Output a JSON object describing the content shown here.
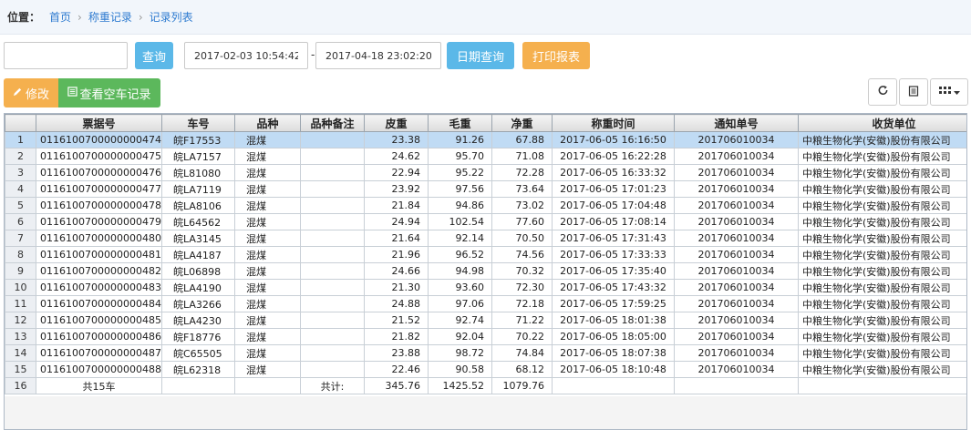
{
  "breadcrumb": {
    "label": "位置：",
    "items": [
      "首页",
      "称重记录",
      "记录列表"
    ],
    "sep": "›"
  },
  "search": {
    "keyword_value": "",
    "query_label": "查询",
    "date_start": "2017-02-03 10:54:42",
    "date_sep": "-",
    "date_end": "2017-04-18 23:02:20",
    "date_query_label": "日期查询",
    "print_label": "打印报表"
  },
  "actions": {
    "edit_label": "修改",
    "empty_label": "查看空车记录"
  },
  "tools": {
    "refresh_icon": "refresh-icon",
    "list_icon": "list-icon",
    "columns_icon": "grid-columns-icon"
  },
  "table": {
    "columns": [
      "",
      "票据号",
      "车号",
      "品种",
      "品种备注",
      "皮重",
      "毛重",
      "净重",
      "称重时间",
      "通知单号",
      "收货单位"
    ],
    "rows": [
      [
        "1",
        "0116100700000000474",
        "皖F17553",
        "混煤",
        "",
        "23.38",
        "91.26",
        "67.88",
        "2017-06-05 16:16:50",
        "201706010034",
        "中粮生物化学(安徽)股份有限公司"
      ],
      [
        "2",
        "0116100700000000475",
        "皖LA7157",
        "混煤",
        "",
        "24.62",
        "95.70",
        "71.08",
        "2017-06-05 16:22:28",
        "201706010034",
        "中粮生物化学(安徽)股份有限公司"
      ],
      [
        "3",
        "0116100700000000476",
        "皖L81080",
        "混煤",
        "",
        "22.94",
        "95.22",
        "72.28",
        "2017-06-05 16:33:32",
        "201706010034",
        "中粮生物化学(安徽)股份有限公司"
      ],
      [
        "4",
        "0116100700000000477",
        "皖LA7119",
        "混煤",
        "",
        "23.92",
        "97.56",
        "73.64",
        "2017-06-05 17:01:23",
        "201706010034",
        "中粮生物化学(安徽)股份有限公司"
      ],
      [
        "5",
        "0116100700000000478",
        "皖LA8106",
        "混煤",
        "",
        "21.84",
        "94.86",
        "73.02",
        "2017-06-05 17:04:48",
        "201706010034",
        "中粮生物化学(安徽)股份有限公司"
      ],
      [
        "6",
        "0116100700000000479",
        "皖L64562",
        "混煤",
        "",
        "24.94",
        "102.54",
        "77.60",
        "2017-06-05 17:08:14",
        "201706010034",
        "中粮生物化学(安徽)股份有限公司"
      ],
      [
        "7",
        "0116100700000000480",
        "皖LA3145",
        "混煤",
        "",
        "21.64",
        "92.14",
        "70.50",
        "2017-06-05 17:31:43",
        "201706010034",
        "中粮生物化学(安徽)股份有限公司"
      ],
      [
        "8",
        "0116100700000000481",
        "皖LA4187",
        "混煤",
        "",
        "21.96",
        "96.52",
        "74.56",
        "2017-06-05 17:33:33",
        "201706010034",
        "中粮生物化学(安徽)股份有限公司"
      ],
      [
        "9",
        "0116100700000000482",
        "皖L06898",
        "混煤",
        "",
        "24.66",
        "94.98",
        "70.32",
        "2017-06-05 17:35:40",
        "201706010034",
        "中粮生物化学(安徽)股份有限公司"
      ],
      [
        "10",
        "0116100700000000483",
        "皖LA4190",
        "混煤",
        "",
        "21.30",
        "93.60",
        "72.30",
        "2017-06-05 17:43:32",
        "201706010034",
        "中粮生物化学(安徽)股份有限公司"
      ],
      [
        "11",
        "0116100700000000484",
        "皖LA3266",
        "混煤",
        "",
        "24.88",
        "97.06",
        "72.18",
        "2017-06-05 17:59:25",
        "201706010034",
        "中粮生物化学(安徽)股份有限公司"
      ],
      [
        "12",
        "0116100700000000485",
        "皖LA4230",
        "混煤",
        "",
        "21.52",
        "92.74",
        "71.22",
        "2017-06-05 18:01:38",
        "201706010034",
        "中粮生物化学(安徽)股份有限公司"
      ],
      [
        "13",
        "0116100700000000486",
        "皖F18776",
        "混煤",
        "",
        "21.82",
        "92.04",
        "70.22",
        "2017-06-05 18:05:00",
        "201706010034",
        "中粮生物化学(安徽)股份有限公司"
      ],
      [
        "14",
        "0116100700000000487",
        "皖C65505",
        "混煤",
        "",
        "23.88",
        "98.72",
        "74.84",
        "2017-06-05 18:07:38",
        "201706010034",
        "中粮生物化学(安徽)股份有限公司"
      ],
      [
        "15",
        "0116100700000000488",
        "皖L62318",
        "混煤",
        "",
        "22.46",
        "90.58",
        "68.12",
        "2017-06-05 18:10:48",
        "201706010034",
        "中粮生物化学(安徽)股份有限公司"
      ]
    ],
    "total_row": [
      "16",
      "共15车",
      "",
      "",
      "共计:",
      "345.76",
      "1425.52",
      "1079.76",
      "",
      "",
      ""
    ],
    "selected_row_index": 0
  }
}
